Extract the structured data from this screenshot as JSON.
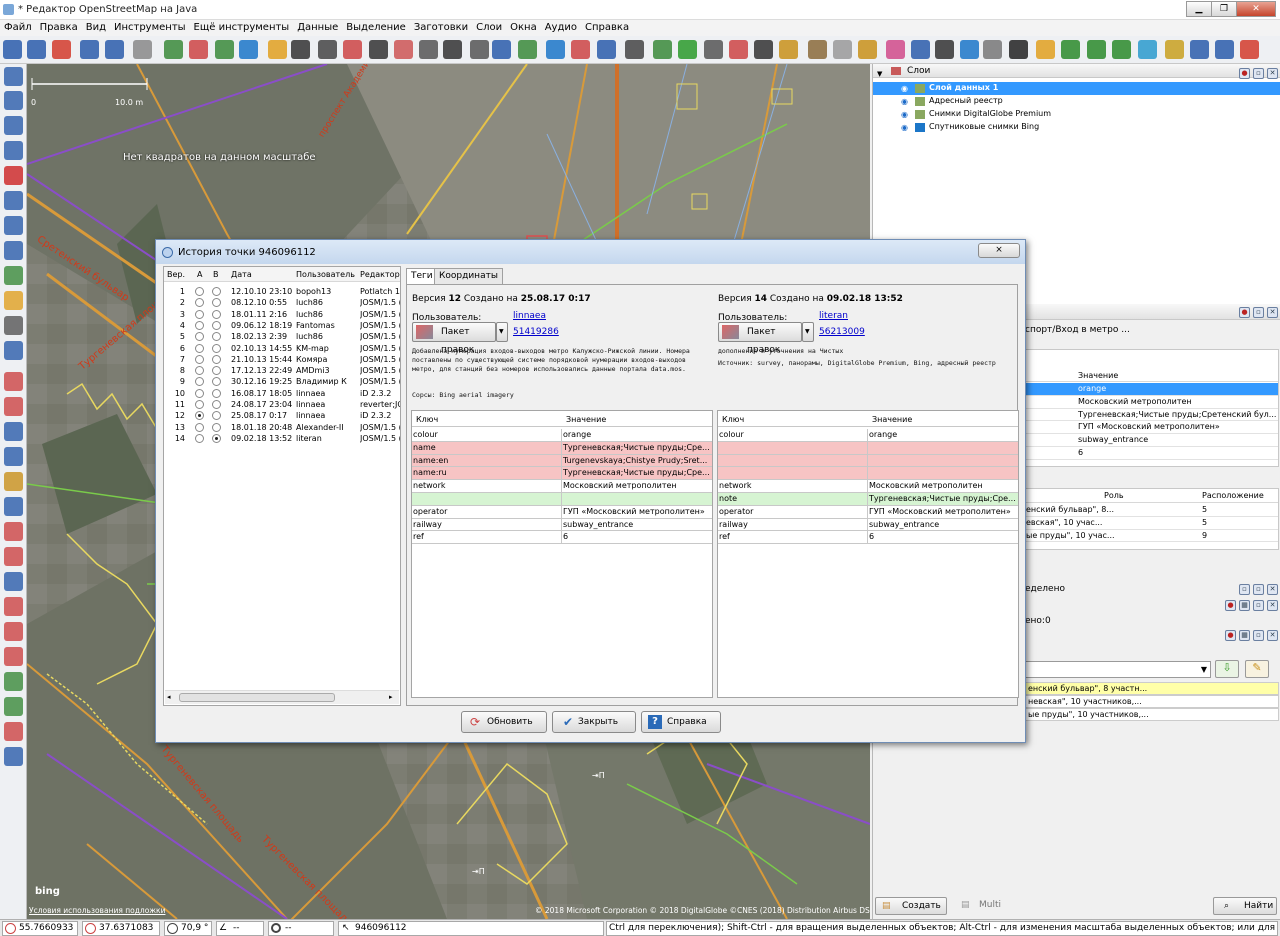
{
  "app": {
    "title": "* Редактор OpenStreetMap на Java"
  },
  "menu": [
    "Файл",
    "Правка",
    "Вид",
    "Инструменты",
    "Ещё инструменты",
    "Данные",
    "Выделение",
    "Заготовки",
    "Слои",
    "Окна",
    "Аудио",
    "Справка"
  ],
  "map": {
    "scale_0": "0",
    "scale_10": "10.0 m",
    "no_imagery": "Нет квадратов на данном масштабе",
    "street1": "Сретенский бульвар",
    "street2": "Тургеневская площадь",
    "street3": "Тургеневская площадь",
    "street4": "Тургеневская площадь",
    "street5": "проспект Академика",
    "credits": "© 2018 Microsoft Corporation © 2018 DigitalGlobe ©CNES (2018) Distribution Airbus DS",
    "bing": "bing",
    "terms": "Условия использования подложки",
    "marker": "⇥П"
  },
  "layers": {
    "title": "Слои",
    "items": [
      {
        "name": "Слой данных 1",
        "active": true
      },
      {
        "name": "Адресный реестр",
        "active": false
      },
      {
        "name": "Снимки DigitalGlobe Premium",
        "active": false
      },
      {
        "name": "Спутниковые снимки Bing",
        "active": false
      }
    ]
  },
  "props": {
    "header": "спорт/Вход в метро ...",
    "value_header": "Значение",
    "values": [
      "orange",
      "Московский метрополитен",
      "Тургеневская;Чистые пруды;Сретенский бул...",
      "ГУП «Московский метрополитен»",
      "subway_entrance",
      "6"
    ],
    "role_header": "Роль",
    "pos_header": "Расположение",
    "rel_rows": [
      {
        "name": "енский бульвар\", 8...",
        "pos": "5"
      },
      {
        "name": "евская\", 10 учас...",
        "pos": "5"
      },
      {
        "name": "ые пруды\", 10 учас...",
        "pos": "9"
      }
    ]
  },
  "sel": {
    "line1": "еделено",
    "line2": "ено:0",
    "rows": [
      "енский бульвар\", 8 участн...",
      "невская\", 10 участников,...",
      "ые пруды\", 10 участников,..."
    ]
  },
  "bottom_buttons": {
    "create": "Создать",
    "multi": "Multi",
    "search": "Найти"
  },
  "status": {
    "lat": "55.7660933",
    "lon": "37.6371083",
    "angle": "70,9 °",
    "dist": "--",
    "len": "--",
    "id": "946096112",
    "hint": "Ctrl для переключения); Shift-Ctrl - для вращения выделенных объектов; Alt-Ctrl - для изменения масштаба выделенных объектов; или для изменения выделения"
  },
  "dialog": {
    "title": "История точки 946096112",
    "close": "⨯",
    "hist_cols": {
      "ver": "Вер.",
      "a": "A",
      "b": "B",
      "date": "Дата",
      "user": "Пользователь",
      "editor": "Редактор"
    },
    "history": [
      {
        "v": "1",
        "date": "12.10.10 23:10",
        "user": "bopoh13",
        "editor": "Potlatch 1."
      },
      {
        "v": "2",
        "date": "08.12.10 0:55",
        "user": "luch86",
        "editor": "JOSM/1.5 ("
      },
      {
        "v": "3",
        "date": "18.01.11 2:16",
        "user": "luch86",
        "editor": "JOSM/1.5 ("
      },
      {
        "v": "4",
        "date": "09.06.12 18:19",
        "user": "Fantomas",
        "editor": "JOSM/1.5 ("
      },
      {
        "v": "5",
        "date": "18.02.13 2:39",
        "user": "luch86",
        "editor": "JOSM/1.5 ("
      },
      {
        "v": "6",
        "date": "02.10.13 14:55",
        "user": "KM-map",
        "editor": "JOSM/1.5 ("
      },
      {
        "v": "7",
        "date": "21.10.13 15:44",
        "user": "Комяра",
        "editor": "JOSM/1.5 ("
      },
      {
        "v": "8",
        "date": "17.12.13 22:49",
        "user": "AMDmi3",
        "editor": "JOSM/1.5 ("
      },
      {
        "v": "9",
        "date": "30.12.16 19:25",
        "user": "Владимир К",
        "editor": "JOSM/1.5 ("
      },
      {
        "v": "10",
        "date": "16.08.17 18:05",
        "user": "linnaea",
        "editor": "iD 2.3.2"
      },
      {
        "v": "11",
        "date": "24.08.17 23:04",
        "user": "linnaea",
        "editor": "reverter;JO"
      },
      {
        "v": "12",
        "date": "25.08.17 0:17",
        "user": "linnaea",
        "editor": "iD 2.3.2"
      },
      {
        "v": "13",
        "date": "18.01.18 20:48",
        "user": "Alexander-II",
        "editor": "JOSM/1.5 ("
      },
      {
        "v": "14",
        "date": "09.02.18 13:52",
        "user": "literan",
        "editor": "JOSM/1.5 ("
      }
    ],
    "tabs": [
      "Теги",
      "Координаты"
    ],
    "left": {
      "version_prefix": "Версия ",
      "version": "12",
      "created": " Создано на ",
      "date": "25.08.17 0:17",
      "user_label": "Пользователь:",
      "user": "linnaea",
      "changeset": "51419286",
      "pkg": "Пакет правок",
      "comment": "Добавлена нумерация входов-выходов метро Калужско-Рижской линии. Номера поставлены по существующей системе порядковой нумерации входов-выходов метро, для станций без номеров использовались данные портала data.mos.",
      "source": "Сорсы: Bing aerial imagery"
    },
    "right": {
      "version_prefix": "Версия ",
      "version": "14",
      "created": " Создано на ",
      "date": "09.02.18 13:52",
      "user_label": "Пользователь:",
      "user": "literan",
      "changeset": "56213009",
      "pkg": "Пакет правок",
      "comment": "дополнения и уточнения на Чистых",
      "source": "Источник: survey, панорамы, DigitalGlobe Premium, Bing, адресный реестр"
    },
    "key_header": "Ключ",
    "value_header": "Значение",
    "left_tags": [
      {
        "k": "colour",
        "v": "orange",
        "c": ""
      },
      {
        "k": "name",
        "v": "Тургеневская;Чистые пруды;Сре...",
        "c": "red"
      },
      {
        "k": "name:en",
        "v": "Turgenevskaya;Chistye Prudy;Sret...",
        "c": "red"
      },
      {
        "k": "name:ru",
        "v": "Тургеневская;Чистые пруды;Сре...",
        "c": "red"
      },
      {
        "k": "network",
        "v": "Московский метрополитен",
        "c": ""
      },
      {
        "k": "",
        "v": "",
        "c": "green"
      },
      {
        "k": "operator",
        "v": "ГУП «Московский метрополитен»",
        "c": ""
      },
      {
        "k": "railway",
        "v": "subway_entrance",
        "c": ""
      },
      {
        "k": "ref",
        "v": "6",
        "c": ""
      }
    ],
    "right_tags": [
      {
        "k": "colour",
        "v": "orange",
        "c": ""
      },
      {
        "k": "",
        "v": "",
        "c": "red"
      },
      {
        "k": "",
        "v": "",
        "c": "red"
      },
      {
        "k": "",
        "v": "",
        "c": "red"
      },
      {
        "k": "network",
        "v": "Московский метрополитен",
        "c": ""
      },
      {
        "k": "note",
        "v": "Тургеневская;Чистые пруды;Сре...",
        "c": "green"
      },
      {
        "k": "operator",
        "v": "ГУП «Московский метрополитен»",
        "c": ""
      },
      {
        "k": "railway",
        "v": "subway_entrance",
        "c": ""
      },
      {
        "k": "ref",
        "v": "6",
        "c": ""
      }
    ],
    "buttons": {
      "refresh": "Обновить",
      "close": "Закрыть",
      "help": "Справка"
    }
  }
}
